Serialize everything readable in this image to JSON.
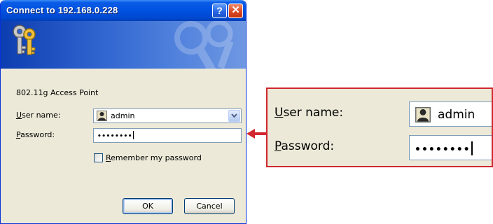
{
  "dialog": {
    "title": "Connect to 192.168.0.228",
    "help_label": "?",
    "close_label": "✕",
    "realm": "802.11g Access Point",
    "user_label_mnemonic": "U",
    "user_label_rest": "ser name:",
    "user_value": "admin",
    "password_label_mnemonic": "P",
    "password_label_rest": "assword:",
    "password_masked": "••••••••",
    "remember_mnemonic": "R",
    "remember_rest": "emember my password",
    "remember_checked": false,
    "ok_label": "OK",
    "cancel_label": "Cancel"
  },
  "zoom": {
    "user_label_mnemonic": "U",
    "user_label_rest": "ser name:",
    "user_value": "admin",
    "password_label_mnemonic": "P",
    "password_label_rest": "assword:",
    "password_masked": "••••••••"
  },
  "colors": {
    "highlight_border": "#d1272f",
    "titlebar": "#0050e0",
    "dialog_bg": "#ece9d8"
  },
  "icons": {
    "banner": "keys-icon",
    "user": "user-icon",
    "dropdown": "chevron-down-icon",
    "pointer": "arrow-left-icon"
  }
}
